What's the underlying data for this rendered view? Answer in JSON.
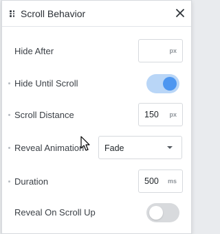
{
  "panel": {
    "title": "Scroll Behavior",
    "icons": {
      "drag": "drag-handle-icon",
      "close": "close-icon"
    }
  },
  "fields": {
    "hide_after": {
      "label": "Hide After",
      "value": "",
      "unit": "px"
    },
    "hide_until_scroll": {
      "label": "Hide Until Scroll",
      "enabled": true
    },
    "scroll_distance": {
      "label": "Scroll Distance",
      "value": "150",
      "unit": "px"
    },
    "reveal_animation": {
      "label": "Reveal Animation",
      "value": "Fade"
    },
    "duration": {
      "label": "Duration",
      "value": "500",
      "unit": "ms"
    },
    "reveal_on_scroll_up": {
      "label": "Reveal On Scroll Up",
      "enabled": false
    }
  },
  "colors": {
    "toggle_on_track": "#b9d6f7",
    "toggle_on_knob": "#4d96f0",
    "toggle_off_track": "#d8dadd"
  }
}
